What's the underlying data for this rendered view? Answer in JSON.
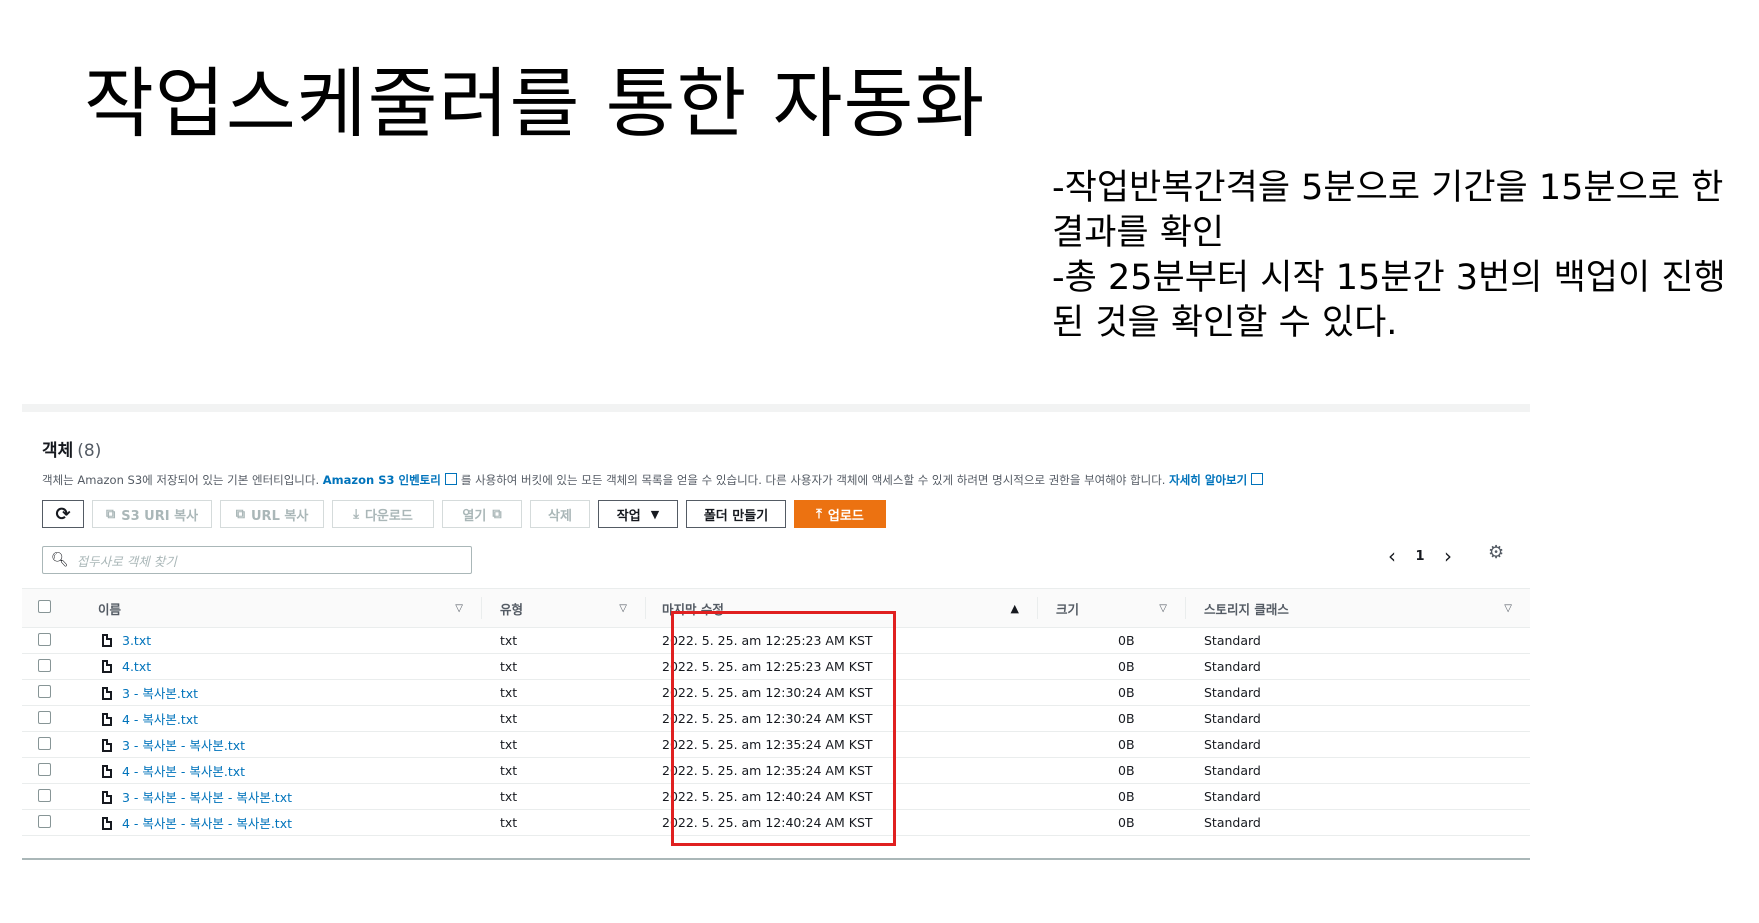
{
  "slide": {
    "title": "작업스케줄러를 통한 자동화",
    "notes": [
      "-작업반복간격을 5분으로 기간을 15분으로 한",
      "결과를 확인",
      "-총 25분부터 시작 15분간 3번의 백업이 진행",
      "된 것을 확인할 수 있다."
    ]
  },
  "objects": {
    "title": "객체",
    "count": "(8)",
    "description_1": "객체는 Amazon S3에 저장되어 있는 기본 엔터티입니다.",
    "inventory_link": "Amazon S3 인벤토리",
    "description_2": "를 사용하여 버킷에 있는 모든 객체의 목록을 얻을 수 있습니다. 다른 사용자가 객체에 액세스할 수 있게 하려면 명시적으로 권한을 부여해야 합니다.",
    "learn_more": "자세히 알아보기",
    "toolbar": {
      "refresh_icon": "⟳",
      "copy_s3_uri": "S3 URI 복사",
      "copy_url": "URL 복사",
      "download": "다운로드",
      "open": "열기",
      "delete": "삭제",
      "actions": "작업",
      "create_folder": "폴더 만들기",
      "upload": "업로드"
    },
    "search_placeholder": "접두사로 객체 찾기",
    "pager": {
      "prev": "‹",
      "page": "1",
      "next": "›"
    },
    "columns": {
      "name": "이름",
      "type": "유형",
      "modified": "마지막 수정",
      "size": "크기",
      "storage": "스토리지 클래스"
    },
    "rows": [
      {
        "name": "3.txt",
        "type": "txt",
        "modified": "2022. 5. 25. am 12:25:23 AM KST",
        "size": "0B",
        "storage": "Standard"
      },
      {
        "name": "4.txt",
        "type": "txt",
        "modified": "2022. 5. 25. am 12:25:23 AM KST",
        "size": "0B",
        "storage": "Standard"
      },
      {
        "name": "3 - 복사본.txt",
        "type": "txt",
        "modified": "2022. 5. 25. am 12:30:24 AM KST",
        "size": "0B",
        "storage": "Standard"
      },
      {
        "name": "4 - 복사본.txt",
        "type": "txt",
        "modified": "2022. 5. 25. am 12:30:24 AM KST",
        "size": "0B",
        "storage": "Standard"
      },
      {
        "name": "3 - 복사본 - 복사본.txt",
        "type": "txt",
        "modified": "2022. 5. 25. am 12:35:24 AM KST",
        "size": "0B",
        "storage": "Standard"
      },
      {
        "name": "4 - 복사본 - 복사본.txt",
        "type": "txt",
        "modified": "2022. 5. 25. am 12:35:24 AM KST",
        "size": "0B",
        "storage": "Standard"
      },
      {
        "name": "3 - 복사본 - 복사본 - 복사본.txt",
        "type": "txt",
        "modified": "2022. 5. 25. am 12:40:24 AM KST",
        "size": "0B",
        "storage": "Standard"
      },
      {
        "name": "4 - 복사본 - 복사본 - 복사본.txt",
        "type": "txt",
        "modified": "2022. 5. 25. am 12:40:24 AM KST",
        "size": "0B",
        "storage": "Standard"
      }
    ]
  },
  "colors": {
    "upload": "#ec7211",
    "link": "#0073bb",
    "highlight": "#e02020"
  }
}
